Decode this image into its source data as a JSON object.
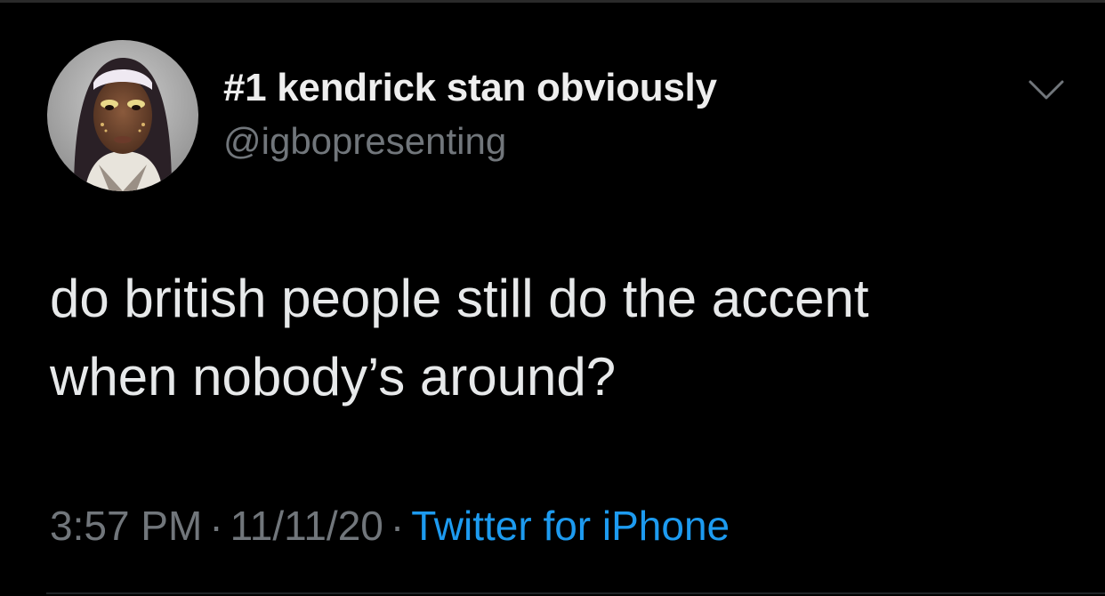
{
  "tweet": {
    "author": {
      "display_name": "#1 kendrick stan obviously",
      "handle": "@igbopresenting",
      "avatar_icon": "profile-photo"
    },
    "text_line1": "do british people still do the accent",
    "text_line2": "when nobody’s around?",
    "time": "3:57 PM",
    "date": "11/11/20",
    "separator": "·",
    "source": "Twitter for iPhone",
    "menu_icon": "chevron-down-icon"
  },
  "colors": {
    "background": "#000000",
    "primary_text": "#e7e9ea",
    "secondary_text": "#71767b",
    "link": "#1d9bf0"
  }
}
